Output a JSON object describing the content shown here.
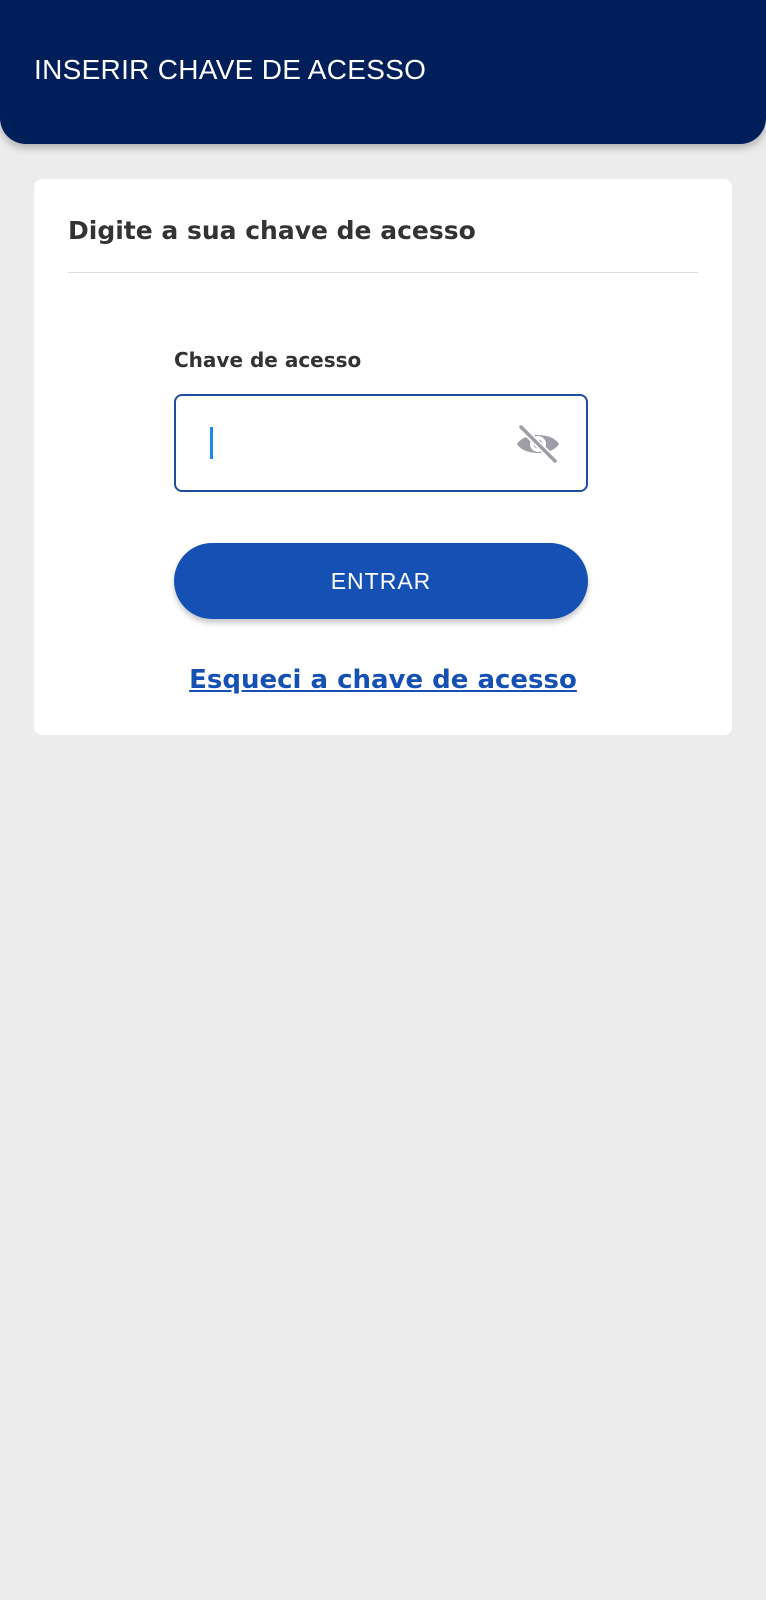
{
  "header": {
    "title": "INSERIR CHAVE DE ACESSO"
  },
  "card": {
    "title": "Digite a sua chave de acesso",
    "field": {
      "label": "Chave de acesso",
      "value": "",
      "placeholder": "",
      "toggle_icon": "eye-off-icon"
    },
    "enter_label": "ENTRAR",
    "forgot_label": "Esqueci a chave de acesso"
  },
  "colors": {
    "header_bg": "#001e5a",
    "accent": "#1551b4",
    "background": "#ececec"
  }
}
